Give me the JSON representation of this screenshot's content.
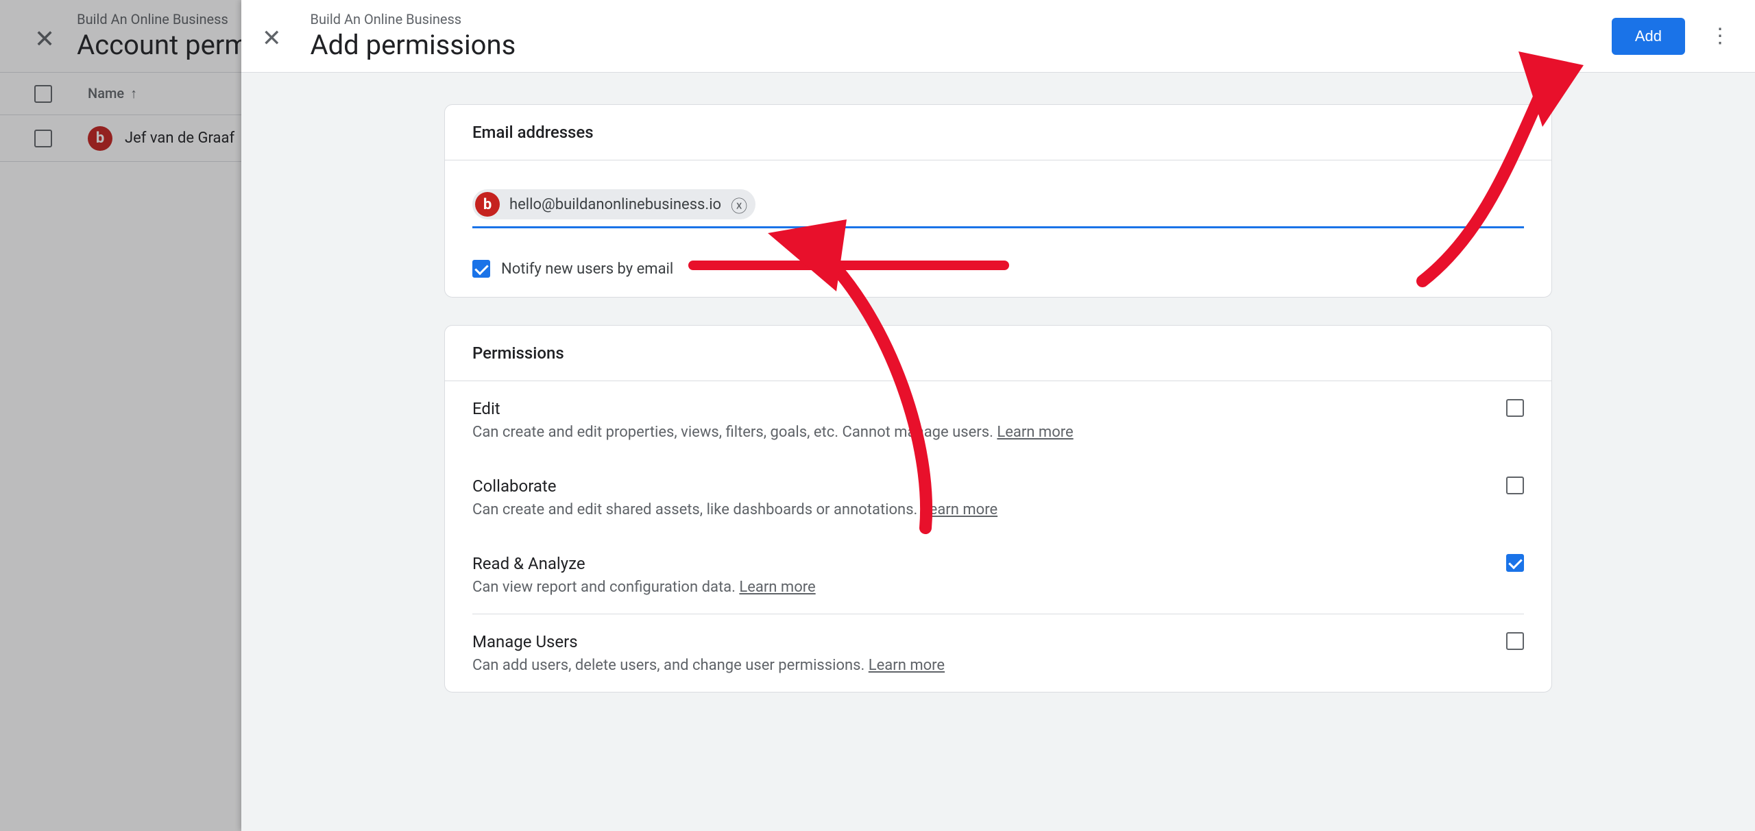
{
  "background": {
    "crumb": "Build An Online Business",
    "title": "Account permissions",
    "column_name": "Name",
    "user_name": "Jef van de Graaf",
    "avatar_letter": "b"
  },
  "modal": {
    "crumb": "Build An Online Business",
    "title": "Add permissions",
    "add_label": "Add"
  },
  "email_card": {
    "header": "Email addresses",
    "chip": {
      "avatar_letter": "b",
      "email": "hello@buildanonlinebusiness.io"
    },
    "notify_label": "Notify new users by email",
    "notify_checked": true
  },
  "perm_card": {
    "header": "Permissions",
    "learn_more": "Learn more",
    "items": [
      {
        "title": "Edit",
        "desc": "Can create and edit properties, views, filters, goals, etc. Cannot manage users.",
        "checked": false
      },
      {
        "title": "Collaborate",
        "desc": "Can create and edit shared assets, like dashboards or annotations.",
        "checked": false
      },
      {
        "title": "Read & Analyze",
        "desc": "Can view report and configuration data.",
        "checked": true
      },
      {
        "title": "Manage Users",
        "desc": "Can add users, delete users, and change user permissions.",
        "checked": false
      }
    ]
  }
}
